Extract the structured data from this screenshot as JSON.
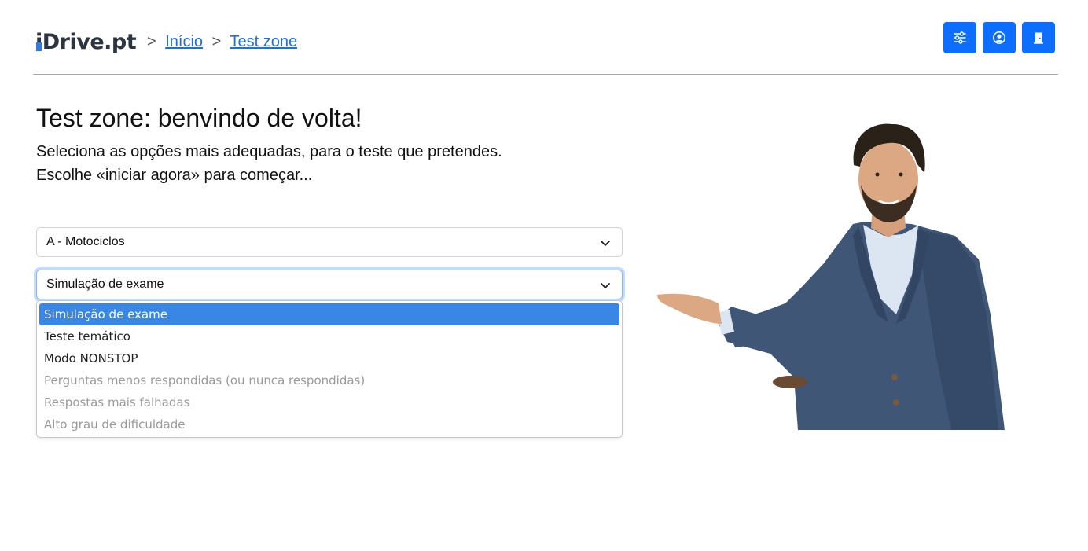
{
  "header": {
    "logo": {
      "prefix": "i",
      "rest": "Drive.pt"
    },
    "breadcrumb": {
      "sep1": ">",
      "home": "Início",
      "sep2": ">",
      "current": "Test zone"
    },
    "buttons": [
      {
        "name": "settings",
        "icon": "sliders-icon"
      },
      {
        "name": "profile",
        "icon": "user-circle-icon"
      },
      {
        "name": "logout",
        "icon": "door-exit-icon"
      }
    ]
  },
  "main": {
    "title": "Test zone: benvindo de volta!",
    "subtitle_line1": "Seleciona as opções mais adequadas, para o teste que pretendes.",
    "subtitle_line2": "Escolhe «iniciar agora» para começar..."
  },
  "category_select": {
    "value": "A - Motociclos"
  },
  "mode_select": {
    "value": "Simulação de exame",
    "options": [
      {
        "label": "Simulação de exame",
        "state": "selected"
      },
      {
        "label": "Teste temático",
        "state": "enabled"
      },
      {
        "label": "Modo NONSTOP",
        "state": "enabled"
      },
      {
        "label": "Perguntas menos respondidas (ou nunca respondidas)",
        "state": "disabled"
      },
      {
        "label": "Respostas mais falhadas",
        "state": "disabled"
      },
      {
        "label": "Alto grau de dificuldade",
        "state": "disabled"
      }
    ]
  },
  "colors": {
    "accent": "#0d6efd",
    "link": "#1b6fe0",
    "option_highlight": "#3a86e4",
    "disabled_text": "#9a9a9a"
  }
}
